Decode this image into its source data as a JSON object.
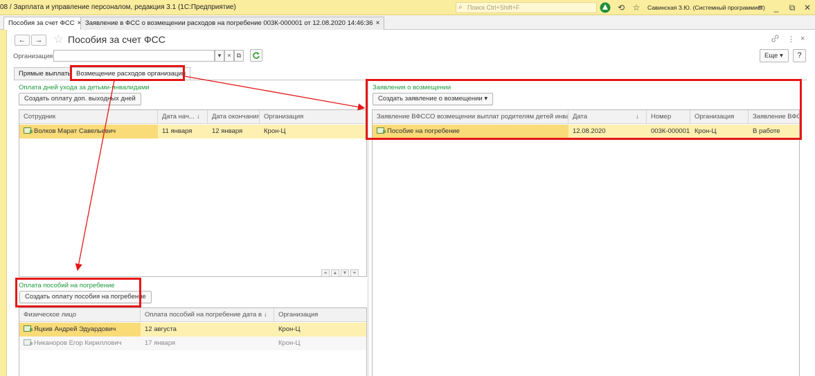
{
  "window": {
    "title": "08 / Зарплата и управление персоналом, редакция 3.1  (1С:Предприятие)",
    "search_placeholder": "Поиск Ctrl+Shift+F",
    "user": "Савинская З.Ю. (Системный программист)"
  },
  "open_tabs": [
    {
      "label": "Пособия за счет ФСС",
      "close": "×"
    },
    {
      "label": "Заявление в ФСС о возмещении расходов на погребение 003К-000001 от 12.08.2020 14:46:36",
      "close": "×"
    }
  ],
  "header": {
    "back": "←",
    "forward": "→",
    "star": "☆",
    "title": "Пособия за счет ФСС",
    "link_icon": "🔗",
    "menu_icon": "⋮",
    "close_icon": "×"
  },
  "filter": {
    "org_label": "Организация:",
    "org_value": "",
    "dropdown": "▾",
    "clear": "×",
    "open": "⧉",
    "refresh": "C",
    "more_label": "Еще ▾",
    "help_label": "?"
  },
  "form_tabs": [
    {
      "label": "Прямые выплаты"
    },
    {
      "label": "Возмещение расходов организации"
    }
  ],
  "care_days": {
    "title": "Оплата дней ухода за детьми-инвалидами",
    "button": "Создать оплату доп. выходных дней",
    "columns": [
      "Сотрудник",
      "Дата нач...",
      "↓",
      "Дата окончания",
      "Организация"
    ],
    "rows": [
      {
        "employee": "Волков Марат Савельевич",
        "start": "11 января",
        "end": "12 января",
        "org": "Крон-Ц"
      }
    ],
    "nav": [
      "⏶",
      "▲",
      "▼",
      "⏷"
    ]
  },
  "claims": {
    "title": "Заявления о возмещении",
    "button": "Создать заявление о возмещении ▾",
    "columns": [
      "Заявление ВФССО возмещении выплат родителям детей инвал...",
      "Дата",
      "↓",
      "Номер",
      "Организация",
      "Заявление ВФС"
    ],
    "rows": [
      {
        "doc": "Пособие на погребение",
        "date": "12.08.2020",
        "number": "003К-000001",
        "org": "Крон-Ц",
        "status": "В работе"
      }
    ]
  },
  "funeral": {
    "title": "Оплата пособий на погребение",
    "button": "Создать оплату пособия на погребение",
    "columns": [
      "Физическое лицо",
      "Оплата пособий на погребение дата вы...",
      "↓",
      "Организация"
    ],
    "rows": [
      {
        "person": "Яцкив Андрей Эдуардович",
        "date": "12 августа",
        "org": "Крон-Ц"
      },
      {
        "person": "Никаноров Егор Кириллович",
        "date": "17 января",
        "org": "Крон-Ц"
      }
    ]
  },
  "colors": {
    "title_bar": "#fbed9e",
    "accent_green": "#1f9a3e",
    "selection": "#fdf0b0",
    "highlight_red": "#e51616"
  }
}
